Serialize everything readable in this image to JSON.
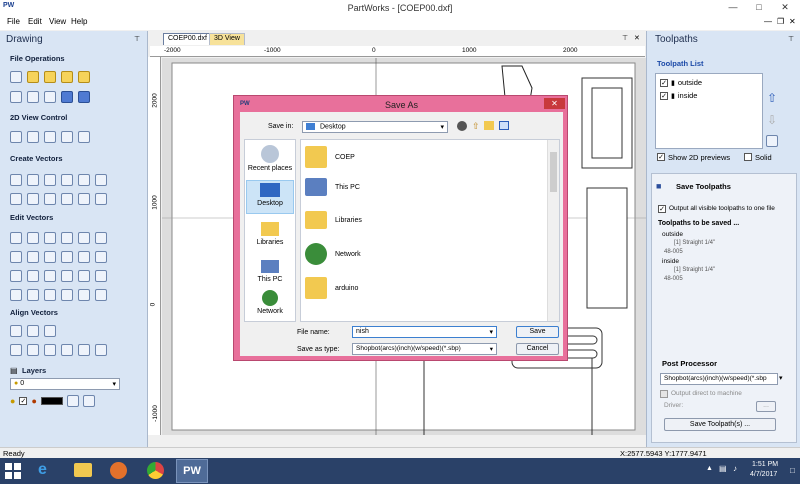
{
  "titlebar": {
    "logo": "PW",
    "title": "PartWorks - [COEP00.dxf]"
  },
  "menu": [
    {
      "label": "File"
    },
    {
      "label": "Edit"
    },
    {
      "label": "View"
    },
    {
      "label": "Help"
    }
  ],
  "left_panel": {
    "title": "Drawing",
    "sections": [
      "File Operations",
      "2D View Control",
      "Create Vectors",
      "Edit Vectors",
      "Align Vectors",
      "Layers"
    ],
    "layer_value": "0"
  },
  "tabs": [
    {
      "label": "COEP00.dxf"
    },
    {
      "label": "3D View"
    }
  ],
  "ruler": {
    "top_ticks": [
      "-2000",
      "-1000",
      "0",
      "1000",
      "2000"
    ],
    "left_ticks": [
      "2000",
      "1000",
      "0",
      "-1000"
    ]
  },
  "right_panel": {
    "title": "Toolpaths",
    "list_title": "Toolpath List",
    "toolpaths": [
      {
        "label": "outside"
      },
      {
        "label": "inside"
      }
    ],
    "show_2d_previews": "Show 2D previews",
    "solid": "Solid",
    "save_title": "Save Toolpaths",
    "output_all": "Output all visible toolpaths to one file",
    "to_be_saved_title": "Toolpaths to be saved ...",
    "saved_items": [
      {
        "name": "outside",
        "detail": "[1] Straight 1/4\"",
        "code": "48-005"
      },
      {
        "name": "inside",
        "detail": "[1] Straight 1/4\"",
        "code": "48-005"
      }
    ],
    "post_processor_title": "Post Processor",
    "post_processor_value": "Shopbot(arcs)(inch)(w/speed)(*.sbp",
    "output_direct": "Output direct to machine",
    "driver_label": "Driver:",
    "driver_button": "...",
    "save_button": "Save Toolpath(s) ..."
  },
  "status": {
    "left": "Ready",
    "coords": "X:2577.5943 Y:1777.9471"
  },
  "taskbar": {
    "time": "1:51 PM",
    "date": "4/7/2017",
    "app": "PW"
  },
  "dialog": {
    "logo": "PW",
    "title": "Save As",
    "save_in_label": "Save in:",
    "save_in_value": "Desktop",
    "nav": [
      {
        "label": "Recent places"
      },
      {
        "label": "Desktop"
      },
      {
        "label": "Libraries"
      },
      {
        "label": "This PC"
      },
      {
        "label": "Network"
      }
    ],
    "files": [
      {
        "label": "COEP"
      },
      {
        "label": "This PC"
      },
      {
        "label": "Libraries"
      },
      {
        "label": "Network"
      },
      {
        "label": "arduino"
      }
    ],
    "file_name_label": "File name:",
    "file_name_value": "nish",
    "save_as_type_label": "Save as type:",
    "save_as_type_value": "Shopbot(arcs)(inch)(w/speed)(*.sbp)",
    "save_button": "Save",
    "cancel_button": "Cancel"
  }
}
